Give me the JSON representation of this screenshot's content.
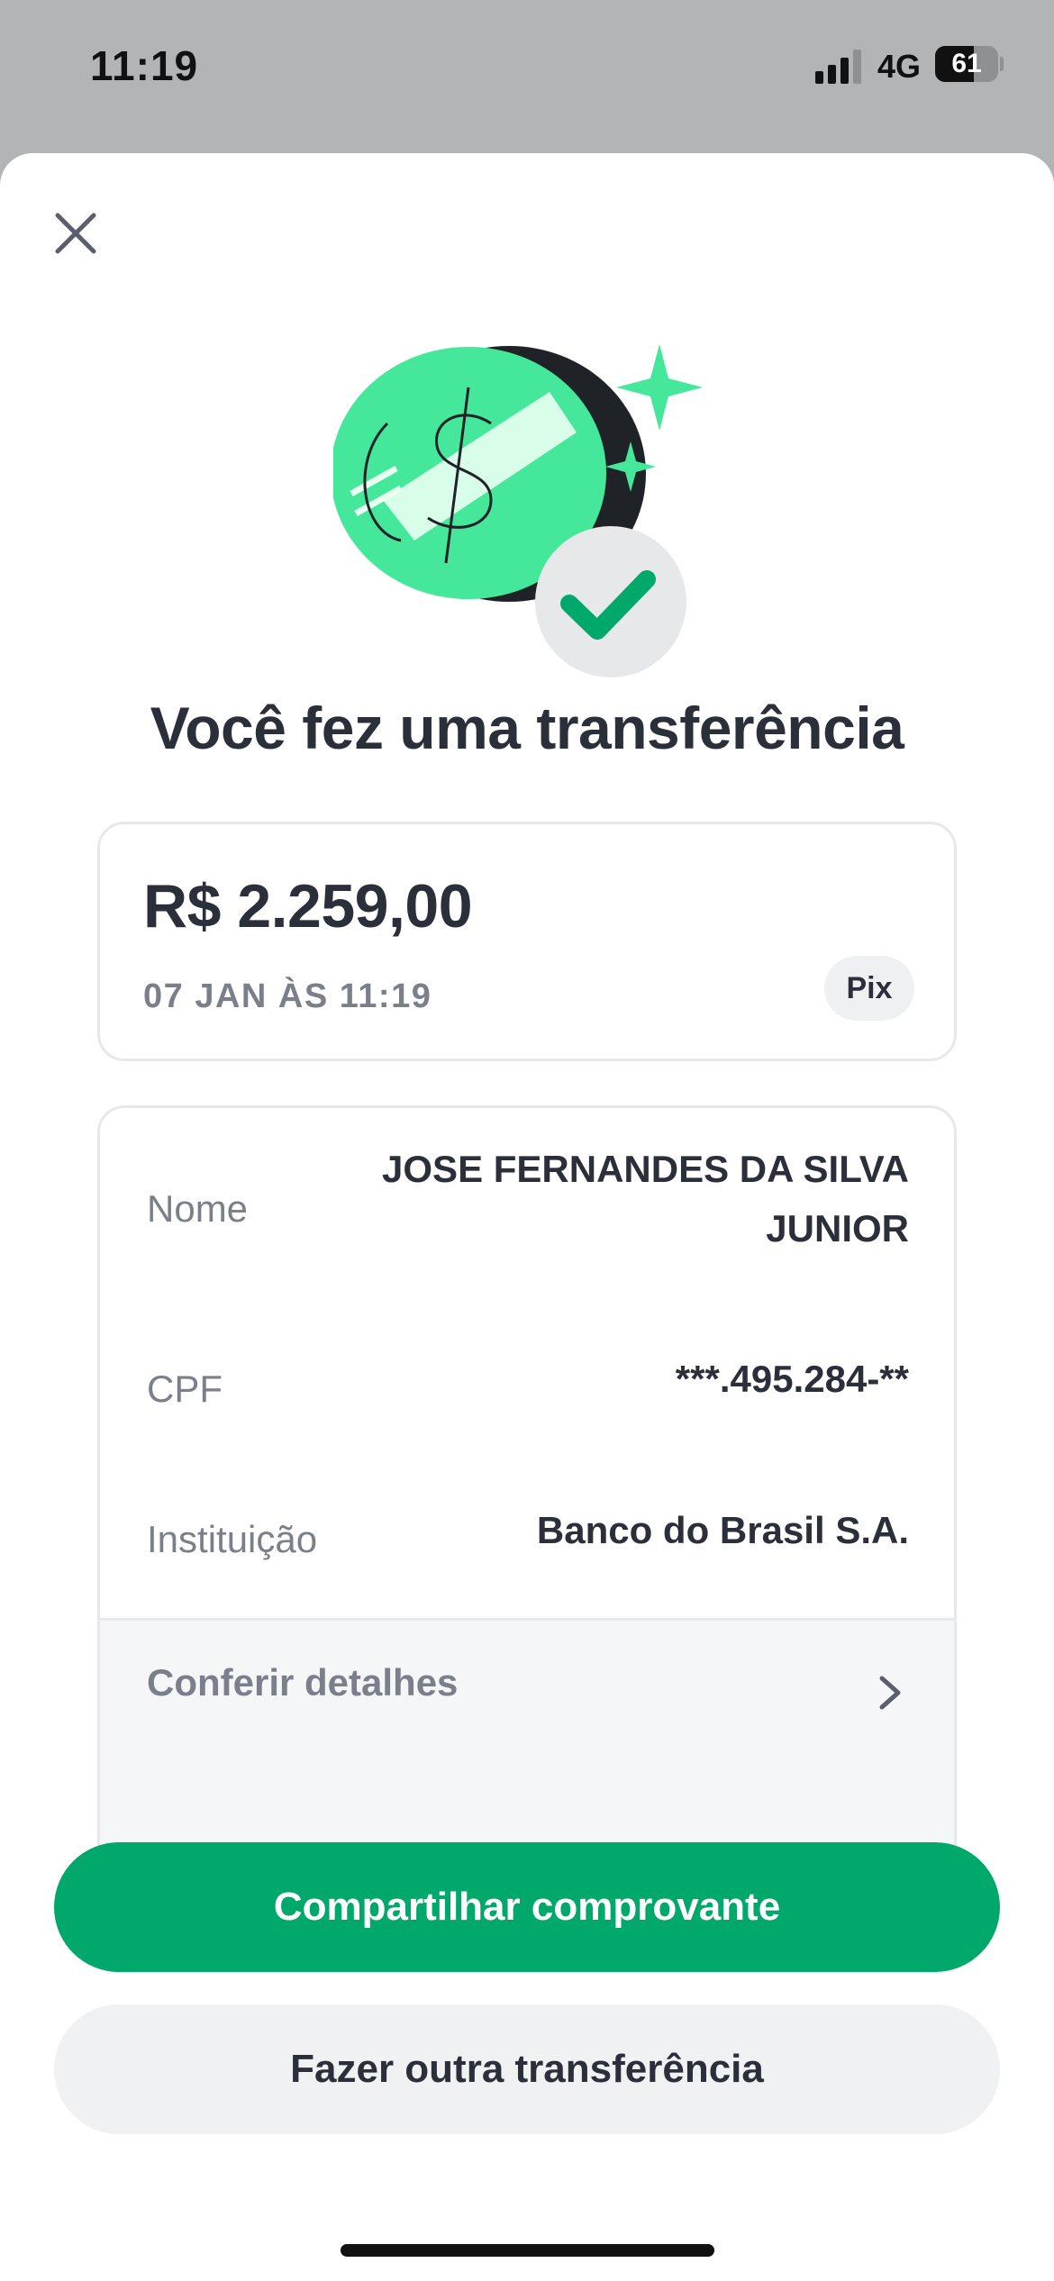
{
  "status_bar": {
    "time": "11:19",
    "network": "4G",
    "battery": "61"
  },
  "sheet": {
    "title": "Você fez uma transferência"
  },
  "amount_card": {
    "amount": "R$ 2.259,00",
    "datetime": "07 JAN ÀS 11:19",
    "badge": "Pix"
  },
  "details": {
    "rows": [
      {
        "label": "Nome",
        "value_line1": "JOSE FERNANDES DA SILVA",
        "value_line2": "JUNIOR"
      },
      {
        "label": "CPF",
        "value": "***.495.284-**"
      },
      {
        "label": "Instituição",
        "value": "Banco do Brasil S.A."
      }
    ],
    "link_label": "Conferir detalhes"
  },
  "actions": {
    "primary_label": "Compartilhar comprovante",
    "secondary_label": "Fazer outra transferência"
  },
  "colors": {
    "accent": "#00a86b",
    "illustration_green": "#45e89a",
    "text_dark": "#2b2f3a",
    "text_muted": "#7a7f8a"
  }
}
